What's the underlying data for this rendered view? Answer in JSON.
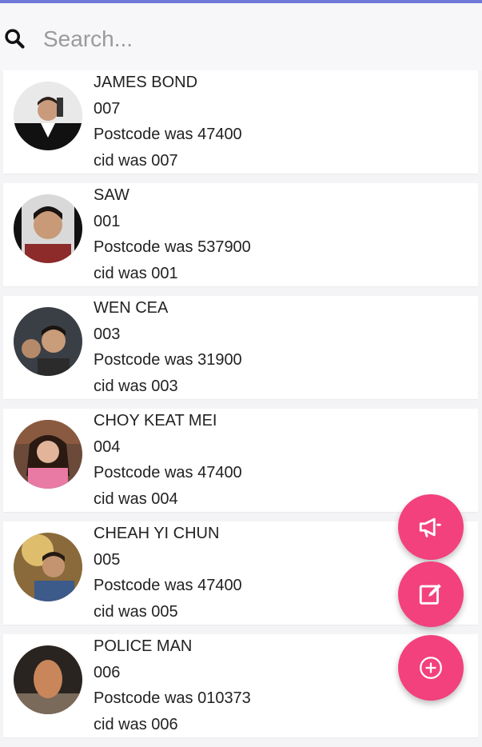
{
  "search": {
    "placeholder": "Search..."
  },
  "contacts": [
    {
      "name": "JAMES BOND",
      "id": "007",
      "postcode": "Postcode was 47400",
      "cid": "cid was 007"
    },
    {
      "name": "SAW",
      "id": "001",
      "postcode": "Postcode was 537900",
      "cid": "cid was 001"
    },
    {
      "name": "WEN CEA",
      "id": "003",
      "postcode": "Postcode was 31900",
      "cid": "cid was 003"
    },
    {
      "name": "CHOY KEAT MEI",
      "id": "004",
      "postcode": "Postcode was 47400",
      "cid": "cid was 004"
    },
    {
      "name": "CHEAH YI CHUN",
      "id": "005",
      "postcode": "Postcode was 47400",
      "cid": "cid was 005"
    },
    {
      "name": "POLICE MAN",
      "id": "006",
      "postcode": "Postcode was 010373",
      "cid": "cid was 006"
    }
  ],
  "fabs": [
    {
      "icon": "megaphone-icon"
    },
    {
      "icon": "edit-icon"
    },
    {
      "icon": "add-circle-icon"
    }
  ],
  "colors": {
    "accent": "#f3417d",
    "top_bar": "#6f79d8"
  }
}
